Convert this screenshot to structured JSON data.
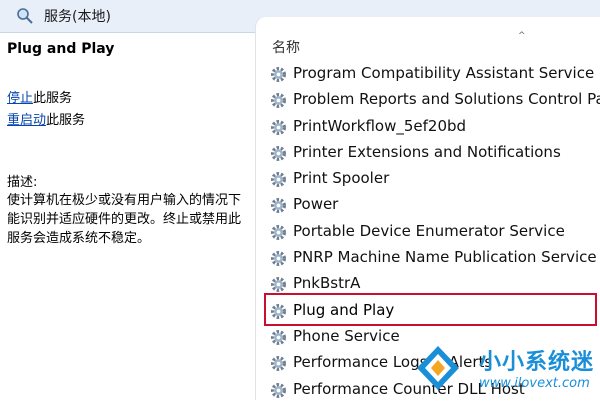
{
  "header": {
    "title": "服务(本地)",
    "icon": "magnifier-icon"
  },
  "left_panel": {
    "service_name": "Plug and Play",
    "stop": {
      "link": "停止",
      "suffix": "此服务"
    },
    "restart": {
      "link": "重启动",
      "suffix": "此服务"
    },
    "description_label": "描述:",
    "description": "使计算机在极少或没有用户输入的情况下能识别并适应硬件的更改。终止或禁用此服务会造成系统不稳定。"
  },
  "list": {
    "column_header": "名称",
    "sort_indicator": "^",
    "items": [
      {
        "label": "Program Compatibility Assistant Service"
      },
      {
        "label": "Problem Reports and Solutions Control Panel"
      },
      {
        "label": "PrintWorkflow_5ef20bd"
      },
      {
        "label": "Printer Extensions and Notifications"
      },
      {
        "label": "Print Spooler"
      },
      {
        "label": "Power"
      },
      {
        "label": "Portable Device Enumerator Service"
      },
      {
        "label": "PNRP Machine Name Publication Service"
      },
      {
        "label": "PnkBstrA"
      },
      {
        "label": "Plug and Play"
      },
      {
        "label": "Phone Service"
      },
      {
        "label": "Performance Logs & Alerts"
      },
      {
        "label": "Performance Counter DLL Host"
      }
    ],
    "selected_index": 9
  },
  "watermark": {
    "text": "小小系统迷",
    "url": "www.ilovext.com"
  },
  "colors": {
    "accent_link": "#0645ad",
    "highlight_border": "#c8102e",
    "watermark": "#1a8fd8"
  }
}
